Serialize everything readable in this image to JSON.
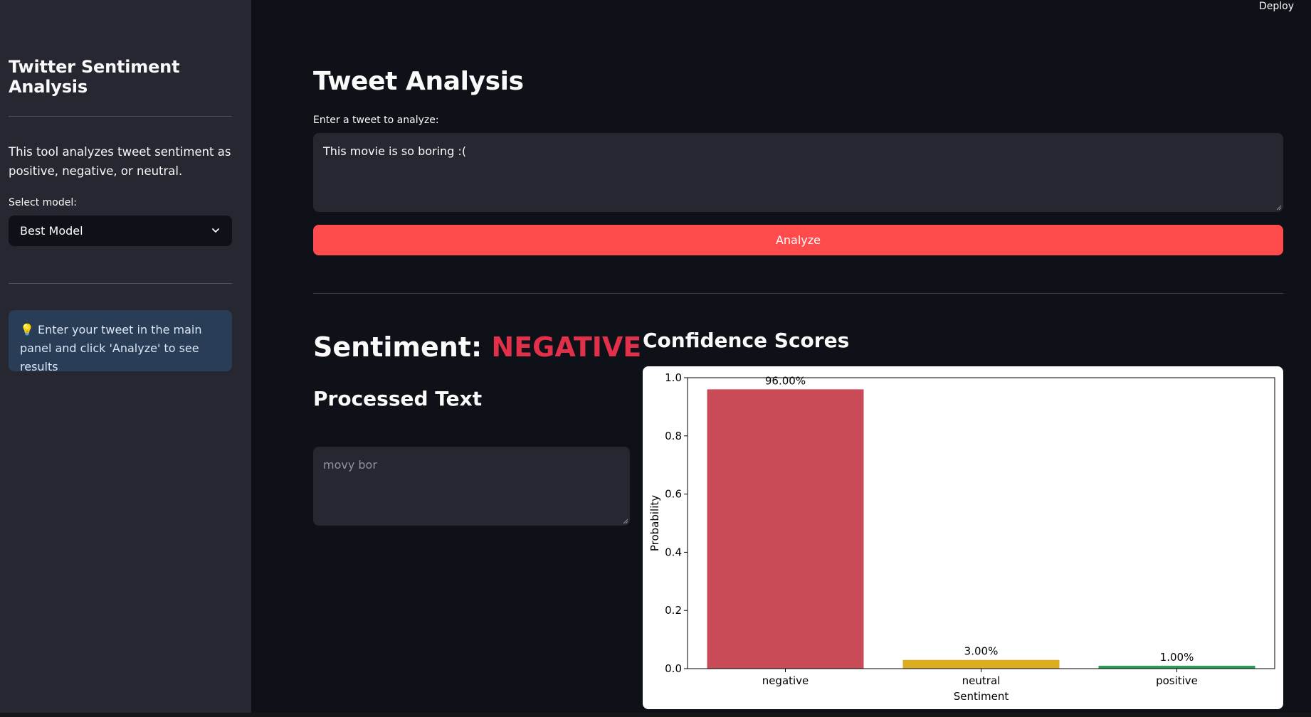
{
  "sidebar": {
    "title": "Twitter Sentiment Analysis",
    "description": "This tool analyzes tweet sentiment as positive, negative, or neutral.",
    "select_label": "Select model:",
    "selected_model": "Best Model",
    "info": "💡 Enter your tweet in the main panel and click 'Analyze' to see results"
  },
  "header": {
    "deploy_label": "Deploy"
  },
  "main": {
    "title": "Tweet Analysis",
    "input_label": "Enter a tweet to analyze:",
    "input_value": "This movie is so boring :(",
    "analyze_label": "Analyze",
    "sentiment_prefix": "Sentiment: ",
    "sentiment_value": "NEGATIVE",
    "processed_title": "Processed Text",
    "processed_value": "movy bor",
    "confidence_title": "Confidence Scores"
  },
  "colors": {
    "accent": "#ff4b4b",
    "negative": "#e0304a",
    "bar_negative": "#c84b57",
    "bar_neutral": "#dbae21",
    "bar_positive": "#2f9a58"
  },
  "chart_data": {
    "type": "bar",
    "categories": [
      "negative",
      "neutral",
      "positive"
    ],
    "values": [
      0.96,
      0.03,
      0.01
    ],
    "data_labels": [
      "96.00%",
      "3.00%",
      "1.00%"
    ],
    "xlabel": "Sentiment",
    "ylabel": "Probability",
    "ylim": [
      0,
      1.0
    ],
    "yticks": [
      "0.0",
      "0.2",
      "0.4",
      "0.6",
      "0.8",
      "1.0"
    ],
    "colors": [
      "#c84b57",
      "#dbae21",
      "#2f9a58"
    ],
    "grid": false
  }
}
